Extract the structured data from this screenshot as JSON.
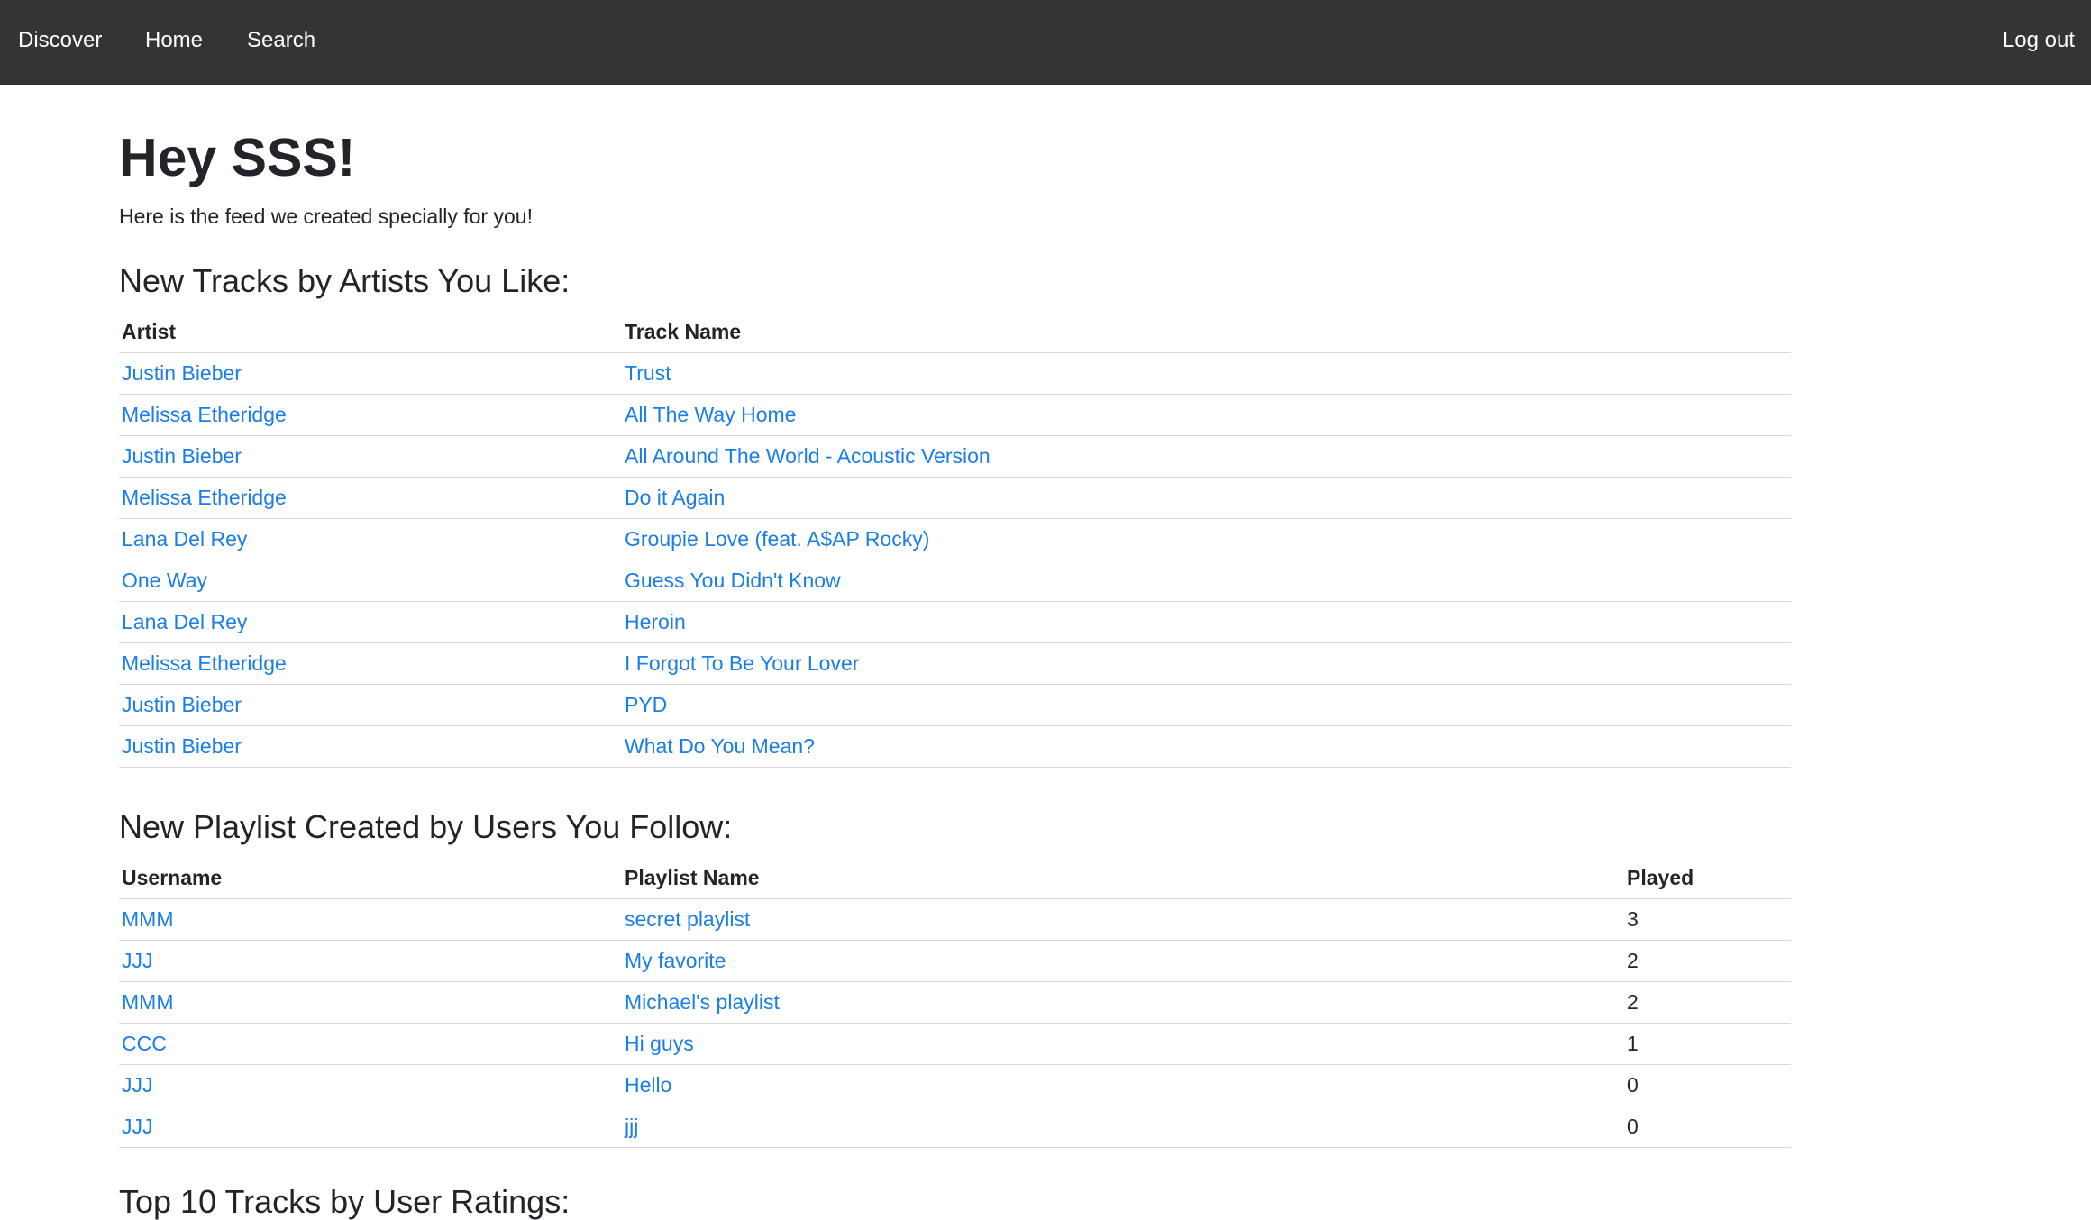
{
  "nav": {
    "discover": "Discover",
    "home": "Home",
    "search": "Search",
    "logout": "Log out"
  },
  "greeting": "Hey SSS!",
  "subtitle": "Here is the feed we created specially for you!",
  "tracks_section": {
    "heading": "New Tracks by Artists You Like:",
    "columns": [
      "Artist",
      "Track Name"
    ],
    "rows": [
      {
        "artist": "Justin Bieber",
        "track": "Trust"
      },
      {
        "artist": "Melissa Etheridge",
        "track": "All The Way Home"
      },
      {
        "artist": "Justin Bieber",
        "track": "All Around The World - Acoustic Version"
      },
      {
        "artist": "Melissa Etheridge",
        "track": "Do it Again"
      },
      {
        "artist": "Lana Del Rey",
        "track": "Groupie Love (feat. A$AP Rocky)"
      },
      {
        "artist": "One Way",
        "track": "Guess You Didn't Know"
      },
      {
        "artist": "Lana Del Rey",
        "track": "Heroin"
      },
      {
        "artist": "Melissa Etheridge",
        "track": "I Forgot To Be Your Lover"
      },
      {
        "artist": "Justin Bieber",
        "track": "PYD"
      },
      {
        "artist": "Justin Bieber",
        "track": "What Do You Mean?"
      }
    ]
  },
  "playlists_section": {
    "heading": "New Playlist Created by Users You Follow:",
    "columns": [
      "Username",
      "Playlist Name",
      "Played"
    ],
    "rows": [
      {
        "username": "MMM",
        "playlist": "secret playlist",
        "played": "3"
      },
      {
        "username": "JJJ",
        "playlist": "My favorite",
        "played": "2"
      },
      {
        "username": "MMM",
        "playlist": "Michael's playlist",
        "played": "2"
      },
      {
        "username": "CCC",
        "playlist": "Hi guys",
        "played": "1"
      },
      {
        "username": "JJJ",
        "playlist": "Hello",
        "played": "0"
      },
      {
        "username": "JJJ",
        "playlist": "jjj",
        "played": "0"
      }
    ]
  },
  "top10_section": {
    "heading": "Top 10 Tracks by User Ratings:"
  },
  "colors": {
    "navbar_bg": "#343434",
    "link": "#1a7ee6",
    "text": "#212529"
  }
}
